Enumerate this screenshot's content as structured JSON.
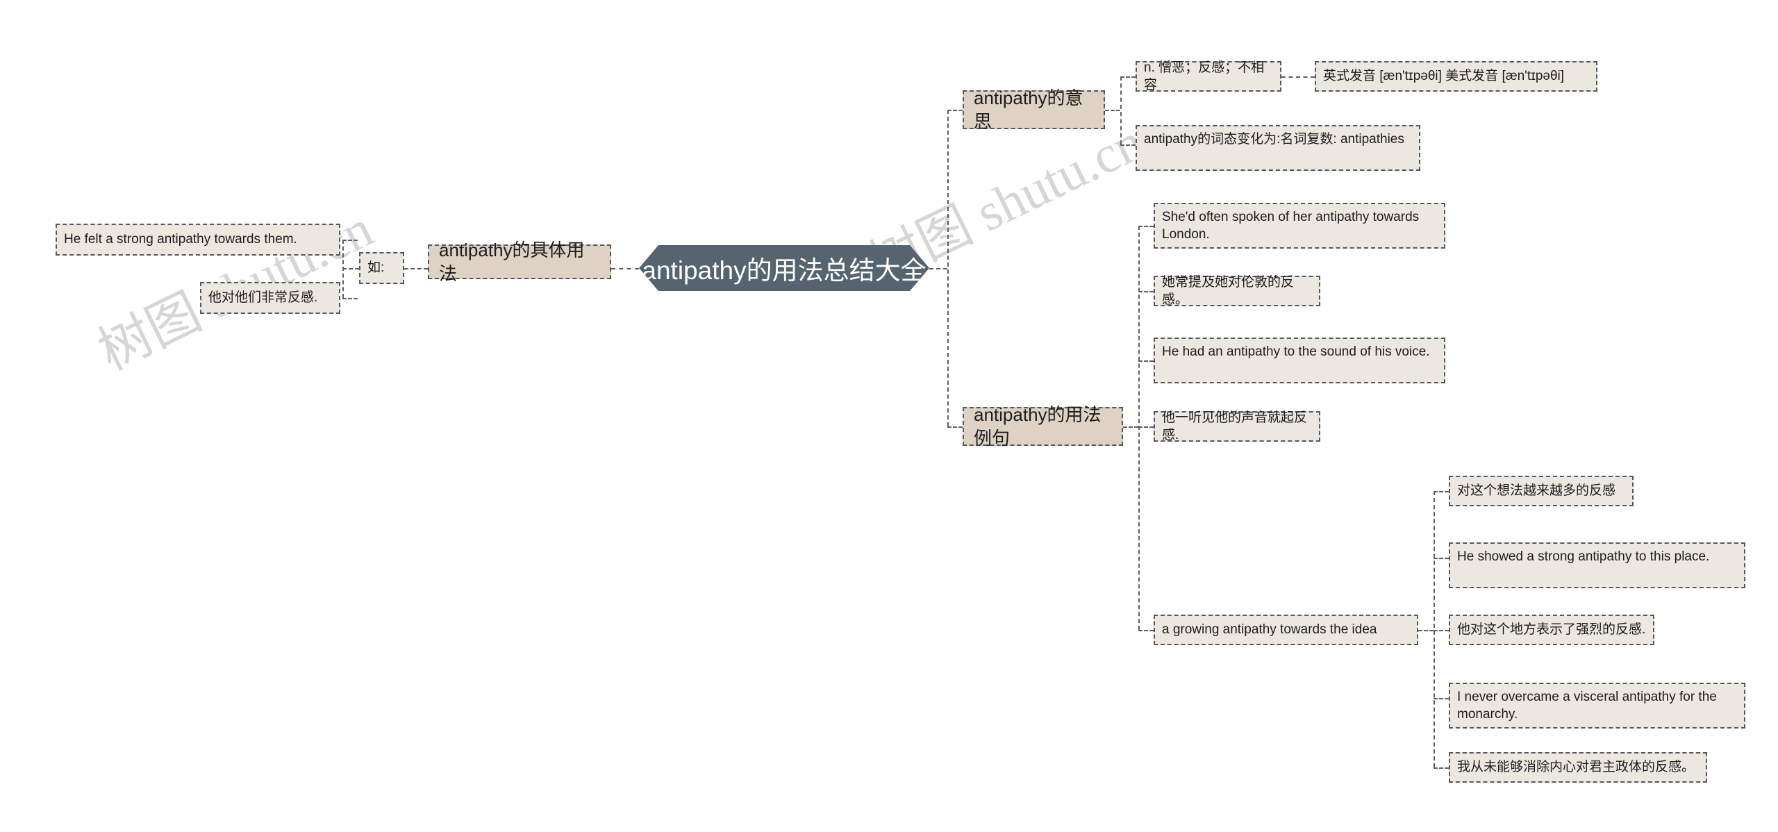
{
  "watermark": {
    "text_left": "树图 shutu.cn",
    "text_right": "树图 shutu.cn",
    "color": "#c9c9c9"
  },
  "colors": {
    "root_fill": "#55646f",
    "root_text": "#ffffff",
    "branch_fill": "#ddd2c4",
    "leaf_fill": "#ece7df",
    "border": "#55585e",
    "text": "#1d1d1d",
    "background": "#ffffff"
  },
  "mindmap": {
    "root": {
      "label": "antipathy的用法总结大全"
    },
    "left_branch": {
      "label": "antipathy的具体用法",
      "connector": {
        "label": "如:"
      },
      "examples": [
        {
          "label": "He felt a strong antipathy towards them."
        },
        {
          "label": "他对他们非常反感."
        }
      ]
    },
    "right_branches": [
      {
        "label": "antipathy的意思",
        "children": [
          {
            "label": "n. 憎恶；反感；不相容",
            "children": [
              {
                "label": "英式发音 [æn'tɪpəθi] 美式发音 [æn'tɪpəθi]"
              }
            ]
          },
          {
            "label": "antipathy的词态变化为:名词复数: antipathies"
          }
        ]
      },
      {
        "label": "antipathy的用法例句",
        "children": [
          {
            "label": "She'd often spoken of her antipathy towards London."
          },
          {
            "label": "她常提及她对伦敦的反感。"
          },
          {
            "label": "He had an antipathy to the sound of his voice."
          },
          {
            "label": "他一听见他的声音就起反感."
          },
          {
            "label": "a growing antipathy towards the idea",
            "children": [
              {
                "label": "对这个想法越来越多的反感"
              },
              {
                "label": "He showed a strong antipathy to this place."
              },
              {
                "label": "他对这个地方表示了强烈的反感."
              },
              {
                "label": "I never overcame a visceral antipathy for the monarchy."
              },
              {
                "label": "我从未能够消除内心对君主政体的反感。"
              }
            ]
          }
        ]
      }
    ]
  }
}
